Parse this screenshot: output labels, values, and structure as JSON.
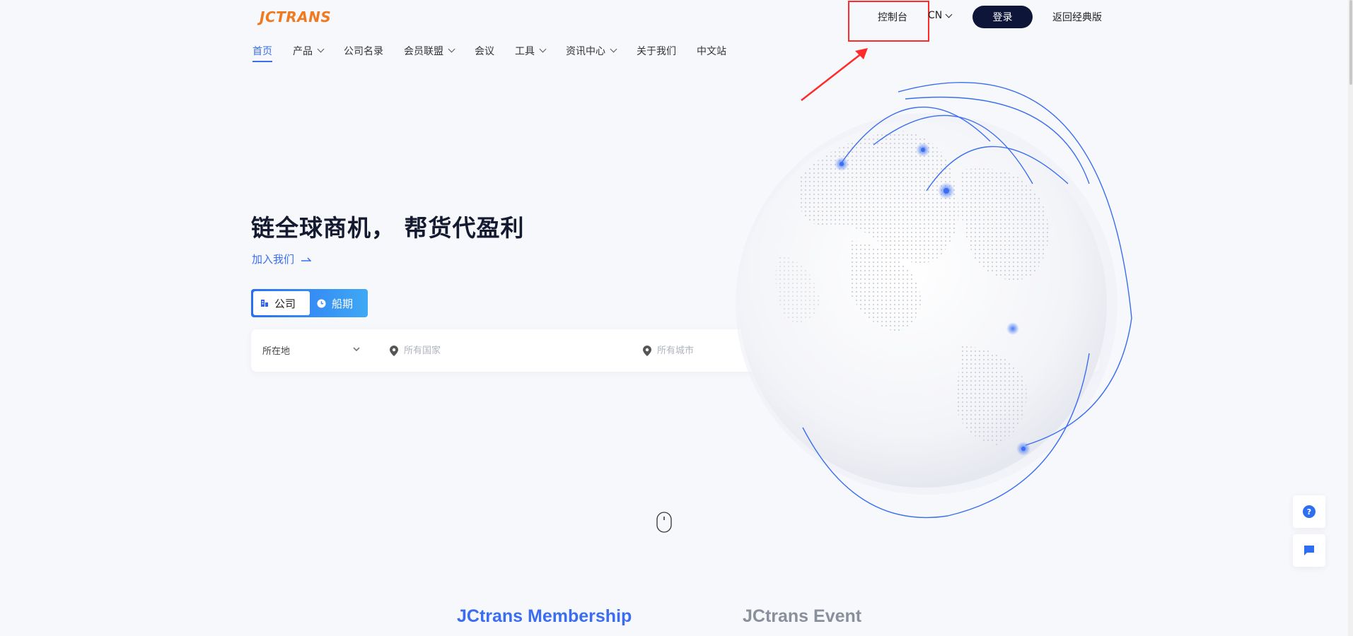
{
  "header": {
    "logo_text": "JCTRANS",
    "nav": [
      {
        "label": "首页",
        "active": true,
        "dropdown": false
      },
      {
        "label": "产品",
        "active": false,
        "dropdown": true
      },
      {
        "label": "公司名录",
        "active": false,
        "dropdown": false
      },
      {
        "label": "会员联盟",
        "active": false,
        "dropdown": true
      },
      {
        "label": "会议",
        "active": false,
        "dropdown": false
      },
      {
        "label": "工具",
        "active": false,
        "dropdown": true
      },
      {
        "label": "资讯中心",
        "active": false,
        "dropdown": true
      },
      {
        "label": "关于我们",
        "active": false,
        "dropdown": false
      },
      {
        "label": "中文站",
        "active": false,
        "dropdown": false
      }
    ],
    "console_label": "控制台",
    "lang_label": "CN",
    "login_label": "登录",
    "classic_label": "返回经典版"
  },
  "hero": {
    "title": "链全球商机， 帮货代盈利",
    "join_label": "加入我们",
    "tabs": [
      {
        "label": "公司",
        "icon": "building-icon",
        "selected": true
      },
      {
        "label": "船期",
        "icon": "clock-icon",
        "selected": false
      }
    ]
  },
  "search": {
    "location_label": "所在地",
    "country_placeholder": "所有国家",
    "city_placeholder": "所有城市"
  },
  "bottom_tabs": {
    "membership": "JCtrans Membership",
    "event": "JCtrans Event"
  },
  "colors": {
    "accent": "#3a6df0",
    "logo": "#f07a1f",
    "login_bg": "#0d1538",
    "annotation": "#ff2a2a"
  }
}
